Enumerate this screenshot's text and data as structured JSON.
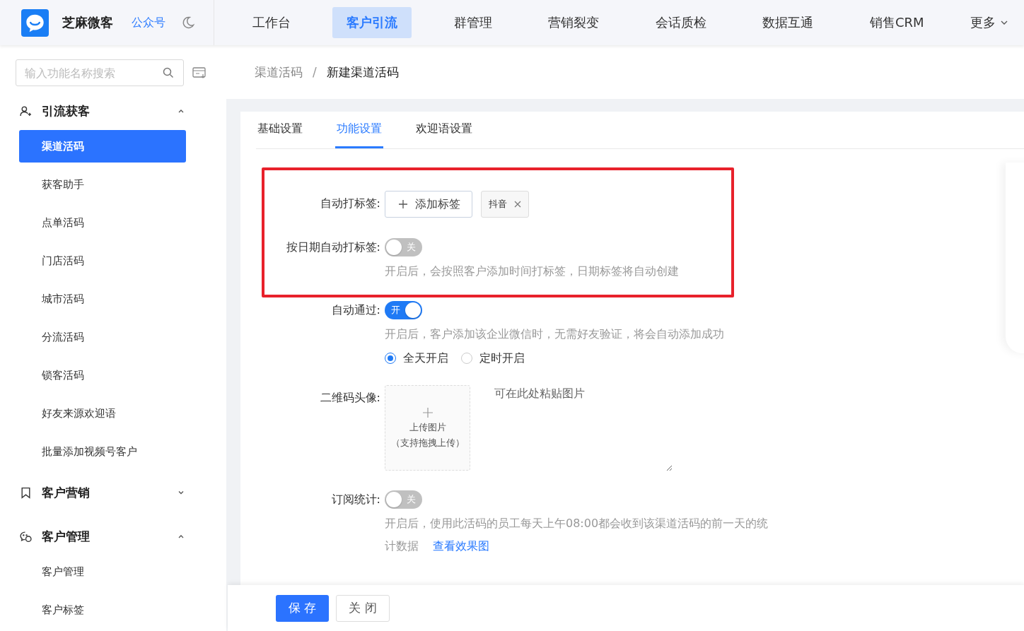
{
  "header": {
    "brand": "芝麻微客",
    "account_link": "公众号",
    "nav": [
      {
        "label": "工作台",
        "selected": false
      },
      {
        "label": "客户引流",
        "selected": true
      },
      {
        "label": "群管理",
        "selected": false
      },
      {
        "label": "营销裂变",
        "selected": false
      },
      {
        "label": "会话质检",
        "selected": false
      },
      {
        "label": "数据互通",
        "selected": false
      },
      {
        "label": "销售CRM",
        "selected": false
      }
    ],
    "more": "更多"
  },
  "sidebar": {
    "search": {
      "placeholder": "输入功能名称搜索"
    },
    "groups": [
      {
        "title": "引流获客",
        "expanded": true,
        "children": [
          {
            "label": "渠道活码",
            "selected": true
          },
          {
            "label": "获客助手",
            "selected": false
          },
          {
            "label": "点单活码",
            "selected": false
          },
          {
            "label": "门店活码",
            "selected": false
          },
          {
            "label": "城市活码",
            "selected": false
          },
          {
            "label": "分流活码",
            "selected": false
          },
          {
            "label": "锁客活码",
            "selected": false
          },
          {
            "label": "好友来源欢迎语",
            "selected": false
          },
          {
            "label": "批量添加视频号客户",
            "selected": false
          }
        ]
      },
      {
        "title": "客户营销",
        "expanded": false
      },
      {
        "title": "客户管理",
        "expanded": true,
        "children": [
          {
            "label": "客户管理",
            "selected": false
          },
          {
            "label": "客户标签",
            "selected": false
          }
        ]
      }
    ]
  },
  "breadcrumb": [
    "渠道活码",
    "/",
    "新建渠道活码"
  ],
  "tabs": [
    {
      "label": "基础设置",
      "selected": false
    },
    {
      "label": "功能设置",
      "selected": true
    },
    {
      "label": "欢迎语设置",
      "selected": false
    }
  ],
  "form": {
    "auto_tag": {
      "label": "自动打标签:",
      "add_button": "添加标签",
      "tags": [
        "抖音"
      ]
    },
    "date_tag": {
      "label": "按日期自动打标签:",
      "switch": {
        "on": false,
        "text": "关"
      },
      "hint": "开启后，会按照客户添加时间打标签，日期标签将自动创建"
    },
    "auto_accept": {
      "label": "自动通过:",
      "switch": {
        "on": true,
        "text": "开"
      },
      "hint": "开启后，客户添加该企业微信时，无需好友验证，将会自动添加成功",
      "options": [
        {
          "label": "全天开启",
          "selected": true
        },
        {
          "label": "定时开启",
          "selected": false
        }
      ]
    },
    "qr_avatar": {
      "label": "二维码头像:",
      "upload_title": "上传图片",
      "upload_note": "（支持拖拽上传）",
      "paste_placeholder": "可在此处粘贴图片"
    },
    "subscription_stats": {
      "label": "订阅统计:",
      "switch": {
        "on": false,
        "text": "关"
      },
      "hint": "开启后，使用此活码的员工每天上午08:00都会收到该渠道活码的前一天的统计数据",
      "link": "查看效果图"
    }
  },
  "footer": {
    "save": "保 存",
    "close": "关 闭"
  }
}
